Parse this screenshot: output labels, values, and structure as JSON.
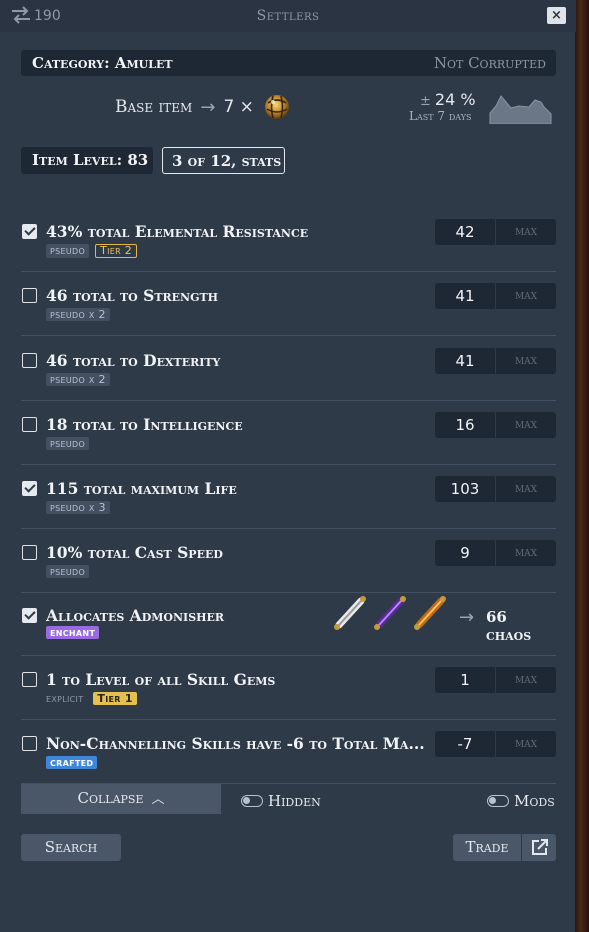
{
  "titlebar": {
    "count": "190",
    "title": "Settlers",
    "close": "×",
    "swap_icon": "swap-arrows-icon"
  },
  "category": {
    "label": "Category: Amulet",
    "corruption": "Not Corrupted"
  },
  "base": {
    "label": "Base item",
    "arrow": "→",
    "count": "7 ×",
    "currency_icon": "orb-icon"
  },
  "trend": {
    "pm": "±",
    "percent": "24 %",
    "period": "Last 7 days"
  },
  "item_level": "Item Level: 83",
  "stats_filter": "3 of 12, stats",
  "rows": [
    {
      "text": "43% total Elemental Resistance",
      "checked": true,
      "tags": [
        "pseudo",
        "Tier 2"
      ],
      "value": "42",
      "max": "max"
    },
    {
      "text": "46 total to Strength",
      "checked": false,
      "tags": [
        "pseudo x 2"
      ],
      "value": "41",
      "max": "max"
    },
    {
      "text": "46 total to Dexterity",
      "checked": false,
      "tags": [
        "pseudo x 2"
      ],
      "value": "41",
      "max": "max"
    },
    {
      "text": "18 total to Intelligence",
      "checked": false,
      "tags": [
        "pseudo"
      ],
      "value": "16",
      "max": "max"
    },
    {
      "text": "115 total maximum Life",
      "checked": true,
      "tags": [
        "pseudo x 3"
      ],
      "value": "103",
      "max": "max"
    },
    {
      "text": "10% total Cast Speed",
      "checked": false,
      "tags": [
        "pseudo"
      ],
      "value": "9",
      "max": "max"
    },
    {
      "text": "Allocates Admonisher",
      "checked": true,
      "tags": [
        "enchant"
      ],
      "arrow": "→",
      "price": "66 chaos"
    },
    {
      "text": "1 to Level of all Skill Gems",
      "checked": false,
      "tags": [
        "explicit",
        "Tier 1"
      ],
      "value": "1",
      "max": "max"
    },
    {
      "text": "Non-Channelling Skills have -6 to Total Ma...",
      "checked": false,
      "tags": [
        "crafted"
      ],
      "value": "-7",
      "max": "max"
    }
  ],
  "footer": {
    "collapse": "Collapse",
    "hidden": "Hidden",
    "mods": "Mods",
    "search": "Search",
    "trade": "Trade"
  },
  "colors": {
    "panel": "#2f3a49",
    "field": "#1e2835",
    "tier_gold": "#e4c04e",
    "enchant": "#9a6ae0",
    "crafted": "#3f86d8"
  }
}
